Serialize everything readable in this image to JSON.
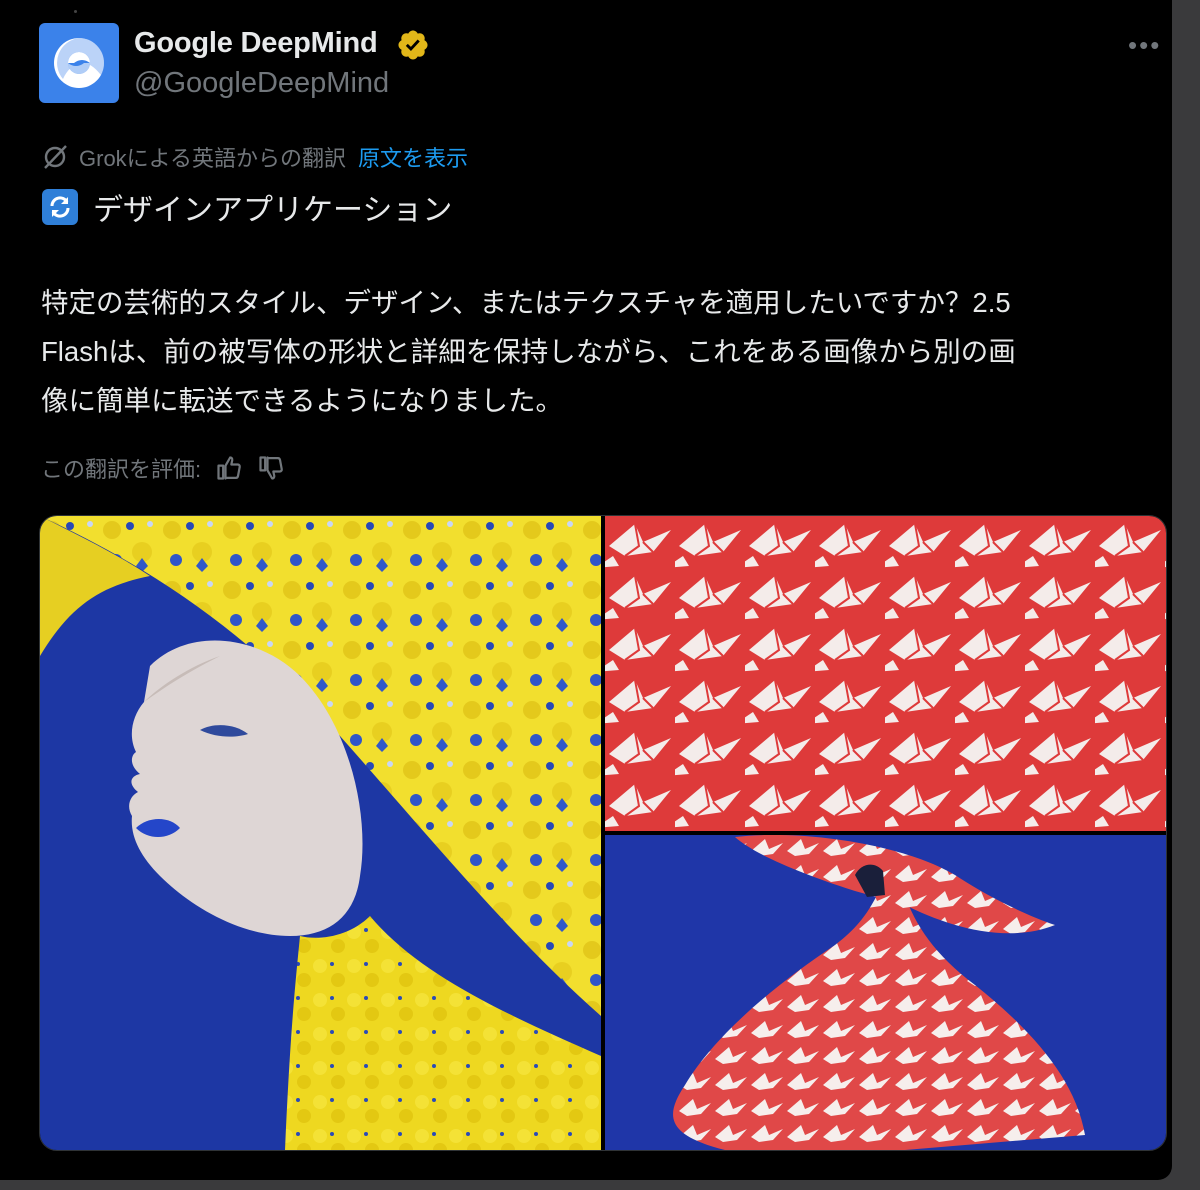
{
  "post": {
    "author_name": "Google DeepMind",
    "author_handle": "@GoogleDeepMind",
    "more_label": "•••",
    "translation_note": "Grokによる英語からの翻訳",
    "show_original": "原文を表示",
    "heading": "デザインアプリケーション",
    "body_lines": [
      "特定の芸術的スタイル、デザイン、またはテクスチャを適用したいですか？2.5",
      "Flashは、前の被写体の形状と詳細を保持しながら、これをある画像から別の画",
      "像に簡単に転送できるようになりました。"
    ],
    "rate_label": "この翻訳を評価:"
  },
  "icons": {
    "avatar": "deepmind-logo-icon",
    "verified": "verified-badge-icon",
    "grok": "grok-icon",
    "heading": "arrows-counterclockwise-emoji-icon",
    "like": "thumbs-up-icon",
    "dislike": "thumbs-down-icon"
  },
  "colors": {
    "background": "#000000",
    "text": "#e7e9ea",
    "muted": "#71767b",
    "link": "#1d9bf0",
    "brand": "#3b82ea",
    "verified": "#e2b719"
  },
  "media": {
    "images": [
      {
        "content": "woman-in-yellow-floral-hat-image"
      },
      {
        "content": "red-paper-crane-pattern-image"
      },
      {
        "content": "figure-in-red-crane-pattern-cape-image"
      }
    ]
  }
}
